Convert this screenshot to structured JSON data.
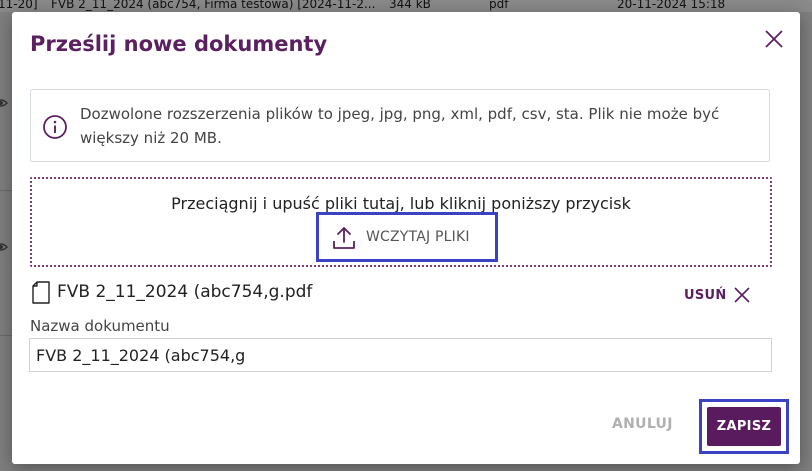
{
  "background": {
    "row": {
      "date_range_fragment": "11-20]",
      "document_title": "FVB 2_11_2024 (abc754, Firma testowa) [2024-11-2...",
      "size": "344 kB",
      "type": "pdf",
      "date": "20-11-2024 15:18"
    }
  },
  "modal": {
    "title": "Prześlij nowe dokumenty",
    "info": {
      "text": "Dozwolone rozszerzenia plików to jpeg, jpg, png, xml, pdf, csv, sta. Plik nie może być większy niż 20 MB."
    },
    "dropzone": {
      "hint": "Przeciągnij i upuść pliki tutaj, lub kliknij poniższy przycisk",
      "upload_label": "WCZYTAJ PLIKI"
    },
    "file": {
      "name": "FVB 2_11_2024 (abc754,g.pdf",
      "remove_label": "USUŃ"
    },
    "document_name": {
      "label": "Nazwa dokumentu",
      "value": "FVB 2_11_2024 (abc754,g"
    },
    "footer": {
      "cancel_label": "ANULUJ",
      "save_label": "ZAPISZ"
    }
  },
  "colors": {
    "brand": "#5a1a5e",
    "highlight": "#3b42c4",
    "overlay": "#7f7f7f"
  }
}
